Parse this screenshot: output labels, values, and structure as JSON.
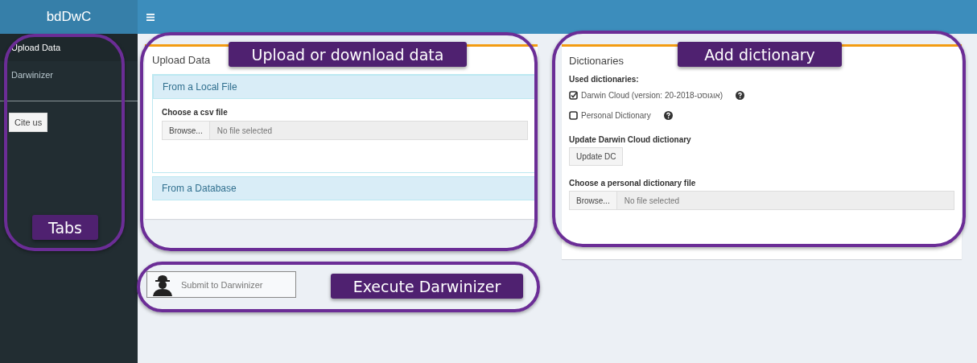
{
  "header": {
    "logo": "bdDwC"
  },
  "sidebar": {
    "items": [
      {
        "label": "Upload Data",
        "selected": true
      },
      {
        "label": "Darwinizer",
        "selected": false
      }
    ],
    "button": "Cite us"
  },
  "upload_box": {
    "title": "Upload Data",
    "panels": [
      {
        "heading": "From a Local File",
        "expanded": true,
        "field_label": "Choose a csv file",
        "browse": "Browse...",
        "placeholder": "No file selected"
      },
      {
        "heading": "From a Database",
        "expanded": false
      }
    ]
  },
  "submit_button": "Submit to Darwinizer",
  "dictionaries_box": {
    "title": "Dictionaries",
    "list_label": "Used dictionaries:",
    "options": [
      {
        "label": "Darwin Cloud (version: 20-אוגוסט-2018)",
        "checked": true
      },
      {
        "label": "Personal Dictionary",
        "checked": false
      }
    ],
    "update_label": "Update Darwin Cloud dictionary",
    "update_button": "Update DC",
    "file_label": "Choose a personal dictionary file",
    "browse": "Browse...",
    "placeholder": "No file selected"
  },
  "annotations": [
    {
      "label": "Tabs"
    },
    {
      "label": "Upload or download data"
    },
    {
      "label": "Add dictionary"
    },
    {
      "label": "Execute Darwinizer"
    }
  ]
}
